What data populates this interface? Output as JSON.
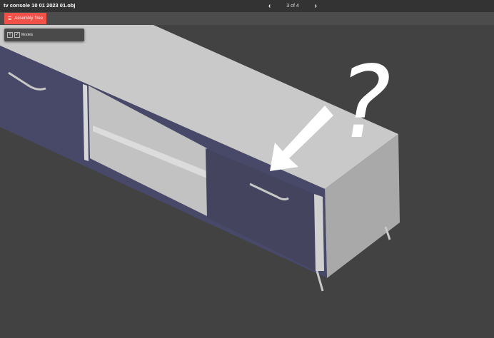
{
  "header": {
    "title": "tv console 10 01 2023 01.obj",
    "page": "3 of 4",
    "prev_icon": "chevron-left-icon",
    "next_icon": "chevron-right-icon"
  },
  "toolbar": {
    "assembly_tree_label": "Assembly Tree",
    "icon": "list-icon"
  },
  "tree": {
    "expand": "+",
    "check": "✓",
    "label": "Models"
  },
  "annotation": {
    "question": "?"
  },
  "colors": {
    "accent": "#f0524a",
    "front": "#4a4a6a",
    "top": "#c8c8c8",
    "side": "#a9a9a9"
  }
}
